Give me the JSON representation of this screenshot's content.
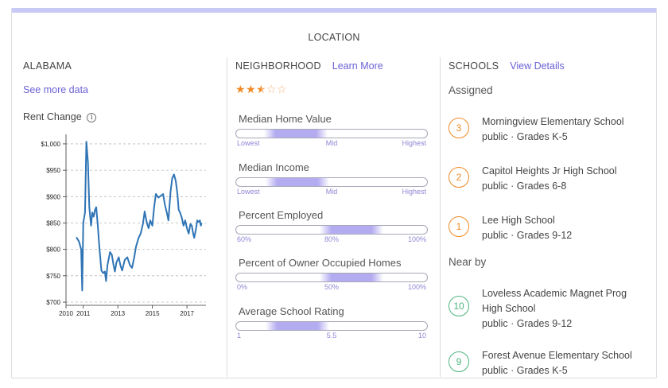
{
  "section_title": "LOCATION",
  "state": {
    "heading": "ALABAMA",
    "see_more": "See more data",
    "rent_label": "Rent Change",
    "info_icon": "i"
  },
  "chart_data": {
    "type": "line",
    "title": "",
    "xlabel": "",
    "ylabel": "",
    "x_tick_labels": [
      "2010",
      "2011",
      "2013",
      "2015",
      "2017"
    ],
    "x_tick_positions": [
      2010,
      2011,
      2013,
      2015,
      2017
    ],
    "y_tick_labels": [
      "$1,000",
      "$950",
      "$900",
      "$850",
      "$800",
      "$750",
      "$700"
    ],
    "y_tick_values": [
      1000,
      950,
      900,
      850,
      800,
      750,
      700
    ],
    "xlim": [
      2010,
      2018.1
    ],
    "ylim": [
      697,
      1015
    ],
    "grid": "horizontal dashed",
    "line_color": "#2f74b5",
    "series": [
      {
        "x": [
          2010.6,
          2010.75,
          2010.88,
          2010.94,
          2011.0,
          2011.1,
          2011.18,
          2011.27,
          2011.35,
          2011.45,
          2011.52,
          2011.6,
          2011.68,
          2011.75,
          2011.84,
          2011.93,
          2012.05,
          2012.15,
          2012.25,
          2012.32,
          2012.4,
          2012.55,
          2012.65,
          2012.75,
          2012.83,
          2012.92,
          2013.05,
          2013.15,
          2013.25,
          2013.4,
          2013.55,
          2013.7,
          2013.82,
          2013.95,
          2014.05,
          2014.2,
          2014.32,
          2014.45,
          2014.55,
          2014.68,
          2014.78,
          2014.88,
          2015.0,
          2015.1,
          2015.2,
          2015.35,
          2015.5,
          2015.62,
          2015.72,
          2015.83,
          2015.93,
          2016.05,
          2016.15,
          2016.25,
          2016.35,
          2016.45,
          2016.52,
          2016.6,
          2016.7,
          2016.8,
          2016.9,
          2017.0,
          2017.1,
          2017.2,
          2017.28,
          2017.36,
          2017.42,
          2017.5,
          2017.6,
          2017.68,
          2017.75,
          2017.8,
          2017.85
        ],
        "y": [
          823,
          815,
          800,
          722,
          850,
          870,
          1004,
          965,
          880,
          845,
          870,
          862,
          875,
          880,
          845,
          805,
          760,
          755,
          758,
          740,
          770,
          795,
          790,
          770,
          758,
          775,
          785,
          770,
          760,
          780,
          785,
          770,
          765,
          785,
          805,
          822,
          830,
          848,
          872,
          850,
          840,
          855,
          845,
          880,
          905,
          898,
          902,
          905,
          885,
          870,
          855,
          910,
          935,
          942,
          930,
          905,
          875,
          870,
          860,
          845,
          855,
          840,
          830,
          848,
          845,
          830,
          822,
          835,
          855,
          852,
          855,
          845,
          850
        ]
      }
    ]
  },
  "neighborhood": {
    "heading": "NEIGHBORHOOD",
    "learn_more": "Learn More",
    "rating": 2.5,
    "rating_max": 5,
    "metrics": [
      {
        "label": "Median Home Value",
        "level": 0.31,
        "ticks": [
          "Lowest",
          "Mid",
          "Highest"
        ]
      },
      {
        "label": "Median Income",
        "level": 0.32,
        "ticks": [
          "Lowest",
          "Mid",
          "Highest"
        ]
      },
      {
        "label": "Percent Employed",
        "level": 0.6,
        "ticks": [
          "60%",
          "80%",
          "100%"
        ]
      },
      {
        "label": "Percent of Owner Occupied Homes",
        "level": 0.6,
        "ticks": [
          "0%",
          "50%",
          "100%"
        ]
      },
      {
        "label": "Average School Rating",
        "level": 0.32,
        "ticks": [
          "1",
          "5.5",
          "10"
        ]
      }
    ]
  },
  "schools": {
    "heading": "SCHOOLS",
    "view_details": "View Details",
    "assigned_label": "Assigned",
    "nearby_label": "Near by",
    "accent_orange": "#f08a24",
    "accent_green": "#4cb57e",
    "assigned": [
      {
        "rating": "3",
        "name": "Morningview Elementary School",
        "meta": "public · Grades K-5"
      },
      {
        "rating": "2",
        "name": "Capitol Heights Jr High School",
        "meta": "public · Grades 6-8"
      },
      {
        "rating": "1",
        "name": "Lee High School",
        "meta": "public · Grades 9-12"
      }
    ],
    "nearby": [
      {
        "rating": "10",
        "name": "Loveless Academic Magnet Prog High School",
        "meta": "public · Grades 9-12"
      },
      {
        "rating": "9",
        "name": "Forest Avenue Elementary School",
        "meta": "public · Grades K-5"
      }
    ]
  }
}
